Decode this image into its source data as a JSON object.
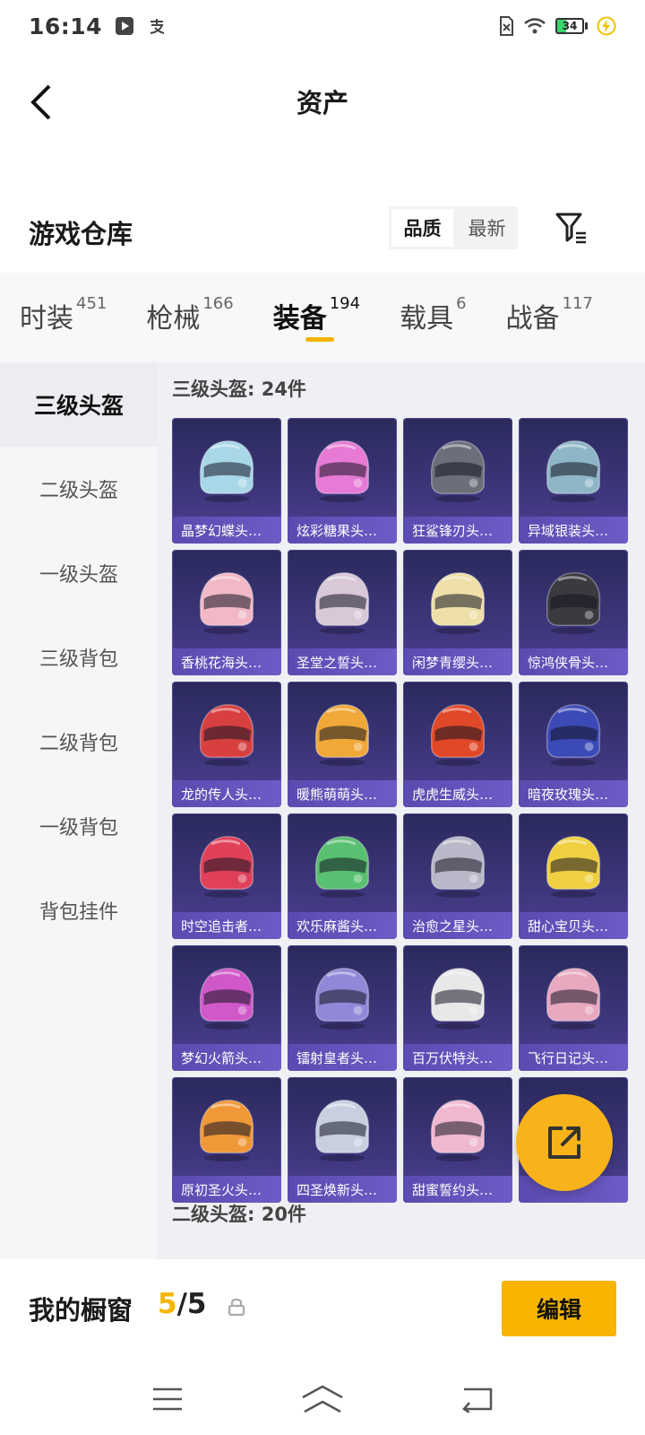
{
  "status_bar": {
    "time": "16:14",
    "battery_level": "34",
    "icons": [
      "play-icon",
      "alipay-icon",
      "sim-icon",
      "wifi-icon",
      "battery-icon",
      "charging-icon"
    ]
  },
  "header": {
    "title": "资产"
  },
  "warehouse": {
    "title": "游戏仓库",
    "sort_options": [
      "品质",
      "最新"
    ],
    "active_sort": "品质"
  },
  "tabs": [
    {
      "label": "时装",
      "count": "451"
    },
    {
      "label": "枪械",
      "count": "166"
    },
    {
      "label": "装备",
      "count": "194"
    },
    {
      "label": "载具",
      "count": "6"
    },
    {
      "label": "战备",
      "count": "117"
    }
  ],
  "active_tab": "装备",
  "sidebar": {
    "items": [
      "三级头盔",
      "二级头盔",
      "一级头盔",
      "三级背包",
      "二级背包",
      "一级背包",
      "背包挂件"
    ],
    "active": "三级头盔"
  },
  "sections": [
    {
      "title": "三级头盔: 24件",
      "items": [
        {
          "name": "晶梦幻蝶头…",
          "color": "#a8d8e8"
        },
        {
          "name": "炫彩糖果头…",
          "color": "#e67ad4"
        },
        {
          "name": "狂鲨锋刃头…",
          "color": "#6a6f7a"
        },
        {
          "name": "异域银装头…",
          "color": "#8fb6c6"
        },
        {
          "name": "香桃花海头…",
          "color": "#f2b8c6"
        },
        {
          "name": "圣堂之誓头…",
          "color": "#d8c8d8"
        },
        {
          "name": "闲梦青缨头…",
          "color": "#eee0a8"
        },
        {
          "name": "惊鸿侠骨头…",
          "color": "#3a3a40"
        },
        {
          "name": "龙的传人头…",
          "color": "#d84040"
        },
        {
          "name": "暖熊萌萌头…",
          "color": "#f0a838"
        },
        {
          "name": "虎虎生威头…",
          "color": "#e04828"
        },
        {
          "name": "暗夜玫瑰头…",
          "color": "#3c4ab8"
        },
        {
          "name": "时空追击者…",
          "color": "#e0405a"
        },
        {
          "name": "欢乐麻酱头…",
          "color": "#58c070"
        },
        {
          "name": "治愈之星头…",
          "color": "#b8b8c8"
        },
        {
          "name": "甜心宝贝头…",
          "color": "#f0d040"
        },
        {
          "name": "梦幻火箭头…",
          "color": "#d058c8"
        },
        {
          "name": "镭射皇者头…",
          "color": "#9088d8"
        },
        {
          "name": "百万伏特头…",
          "color": "#e8e8e8"
        },
        {
          "name": "飞行日记头…",
          "color": "#e8a8c0"
        },
        {
          "name": "原初圣火头…",
          "color": "#f09838"
        },
        {
          "name": "四圣焕新头…",
          "color": "#c8d0e0"
        },
        {
          "name": "甜蜜誓约头…",
          "color": "#f0b8d0"
        },
        {
          "name": "",
          "color": "#50a0d0"
        }
      ]
    },
    {
      "title": "二级头盔: 20件",
      "items": []
    }
  ],
  "showcase": {
    "label": "我的橱窗",
    "current": "5",
    "separator": "/",
    "total": "5",
    "edit_label": "编辑"
  },
  "colors": {
    "accent": "#f7b400",
    "card_bg": "#3c3579",
    "card_label_bg": "#5a4bb0"
  }
}
